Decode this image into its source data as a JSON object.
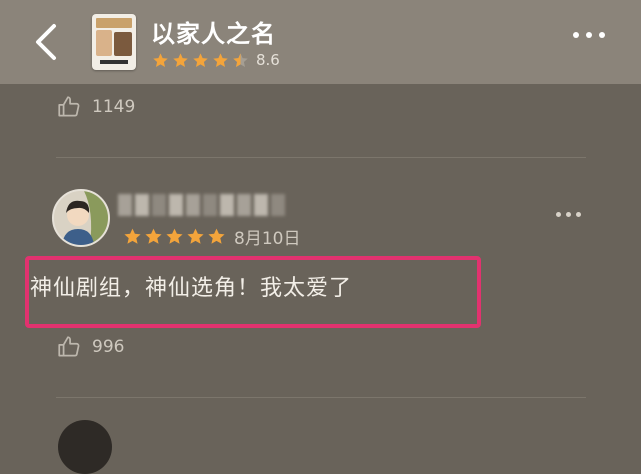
{
  "header": {
    "title": "以家人之名",
    "rating": "8.6",
    "rating_stars": 4.5,
    "back_icon": "chevron-left-icon",
    "more_icon": "more-horizontal-icon"
  },
  "previous_comment": {
    "like_count": "1149"
  },
  "comment": {
    "stars": 5,
    "date": "8月10日",
    "text": "神仙剧组，神仙选角！我太爱了",
    "like_count": "996",
    "highlight_color": "#e2326f"
  },
  "colors": {
    "star": "#f3a43b",
    "header_bg": "#8b847a",
    "page_bg": "#69635a"
  }
}
